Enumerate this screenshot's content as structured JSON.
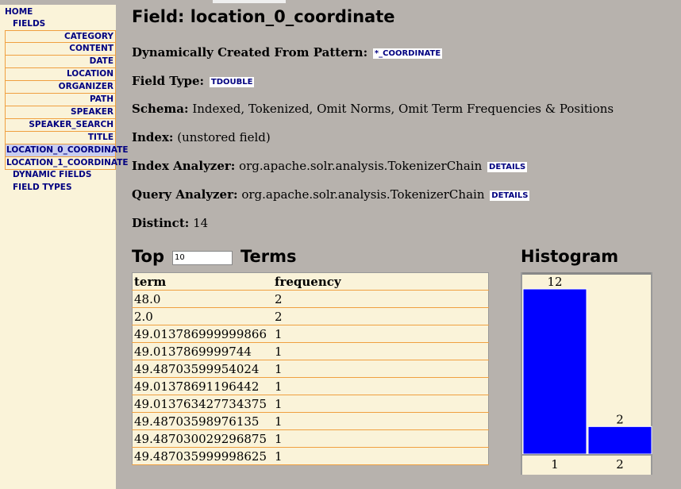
{
  "sidebar": {
    "home": "HOME",
    "fields": "FIELDS",
    "field_items": [
      {
        "label": "CATEGORY",
        "selected": false
      },
      {
        "label": "CONTENT",
        "selected": false
      },
      {
        "label": "DATE",
        "selected": false
      },
      {
        "label": "LOCATION",
        "selected": false
      },
      {
        "label": "ORGANIZER",
        "selected": false
      },
      {
        "label": "PATH",
        "selected": false
      },
      {
        "label": "SPEAKER",
        "selected": false
      },
      {
        "label": "SPEAKER_SEARCH",
        "selected": false
      },
      {
        "label": "TITLE",
        "selected": false
      },
      {
        "label": "LOCATION_0_COORDINATE",
        "selected": true
      },
      {
        "label": "LOCATION_1_COORDINATE",
        "selected": false
      }
    ],
    "dynamic_fields": "DYNAMIC FIELDS",
    "field_types": "FIELD TYPES"
  },
  "main": {
    "title": "Field: location_0_coordinate",
    "dynamic_label": "Dynamically Created From Pattern:",
    "dynamic_value": "*_COORDINATE",
    "field_type_label": "Field Type:",
    "field_type_value": "TDOUBLE",
    "schema_label": "Schema:",
    "schema_value": "Indexed, Tokenized, Omit Norms, Omit Term Frequencies & Positions",
    "index_label": "Index:",
    "index_value": "(unstored field)",
    "index_analyzer_label": "Index Analyzer:",
    "index_analyzer_value": "org.apache.solr.analysis.TokenizerChain",
    "query_analyzer_label": "Query Analyzer:",
    "query_analyzer_value": "org.apache.solr.analysis.TokenizerChain",
    "details_label": "DETAILS",
    "distinct_label": "Distinct:",
    "distinct_value": "14"
  },
  "top_terms": {
    "heading_before": "Top",
    "count_value": "10",
    "heading_after": "Terms",
    "columns": [
      "term",
      "frequency"
    ],
    "rows": [
      [
        "48.0",
        "2"
      ],
      [
        "2.0",
        "2"
      ],
      [
        "49.013786999999866",
        "1"
      ],
      [
        "49.0137869999744",
        "1"
      ],
      [
        "49.48703599954024",
        "1"
      ],
      [
        "49.01378691196442",
        "1"
      ],
      [
        "49.0137634277343​75",
        "1"
      ],
      [
        "49.48703598976135",
        "1"
      ],
      [
        "49.487030029296875",
        "1"
      ],
      [
        "49.487035999998625",
        "1"
      ]
    ]
  },
  "chart_data": {
    "type": "bar",
    "title": "Histogram",
    "categories": [
      "1",
      "2"
    ],
    "values": [
      12,
      2
    ],
    "ylim": [
      0,
      12
    ],
    "bar_color": "#0000ff"
  }
}
